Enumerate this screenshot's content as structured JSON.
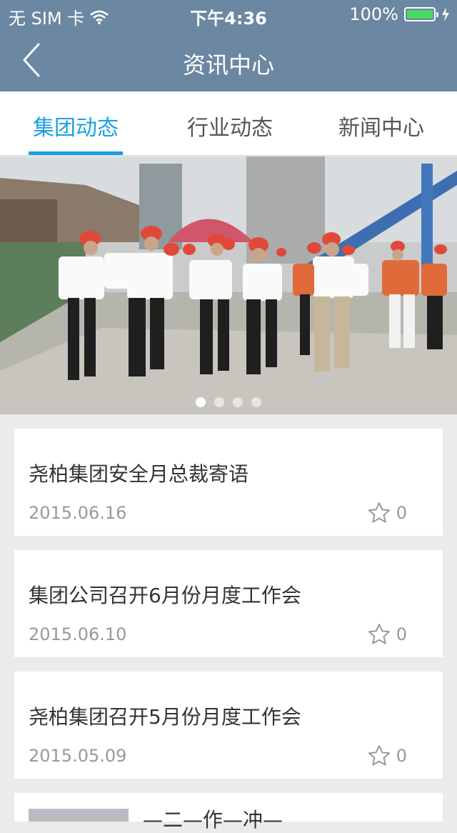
{
  "status_bar": {
    "carrier": "无 SIM 卡",
    "time": "下午4:36",
    "battery": "100%"
  },
  "nav": {
    "title": "资讯中心"
  },
  "tabs": [
    {
      "label": "集团动态",
      "active": true
    },
    {
      "label": "行业动态",
      "active": false
    },
    {
      "label": "新闻中心",
      "active": false
    }
  ],
  "banner": {
    "page_count": 4,
    "current_page": 1
  },
  "articles": [
    {
      "title": "尧柏集团安全月总裁寄语",
      "date": "2015.06.16",
      "favorites": "0"
    },
    {
      "title": "集团公司召开6月份月度工作会",
      "date": "2015.06.10",
      "favorites": "0"
    },
    {
      "title": "尧柏集团召开5月份月度工作会",
      "date": "2015.05.09",
      "favorites": "0"
    }
  ],
  "partial_article": {
    "title": "—二—作—冲—"
  },
  "colors": {
    "nav_bg": "#6b87a1",
    "accent": "#1aa0e4",
    "page_bg": "#ebebeb",
    "battery_green": "#4cd964"
  },
  "icons": {
    "back": "chevron-left-icon",
    "wifi": "wifi-icon",
    "battery": "battery-icon",
    "charging": "bolt-icon",
    "favorite": "star-outline-icon"
  }
}
